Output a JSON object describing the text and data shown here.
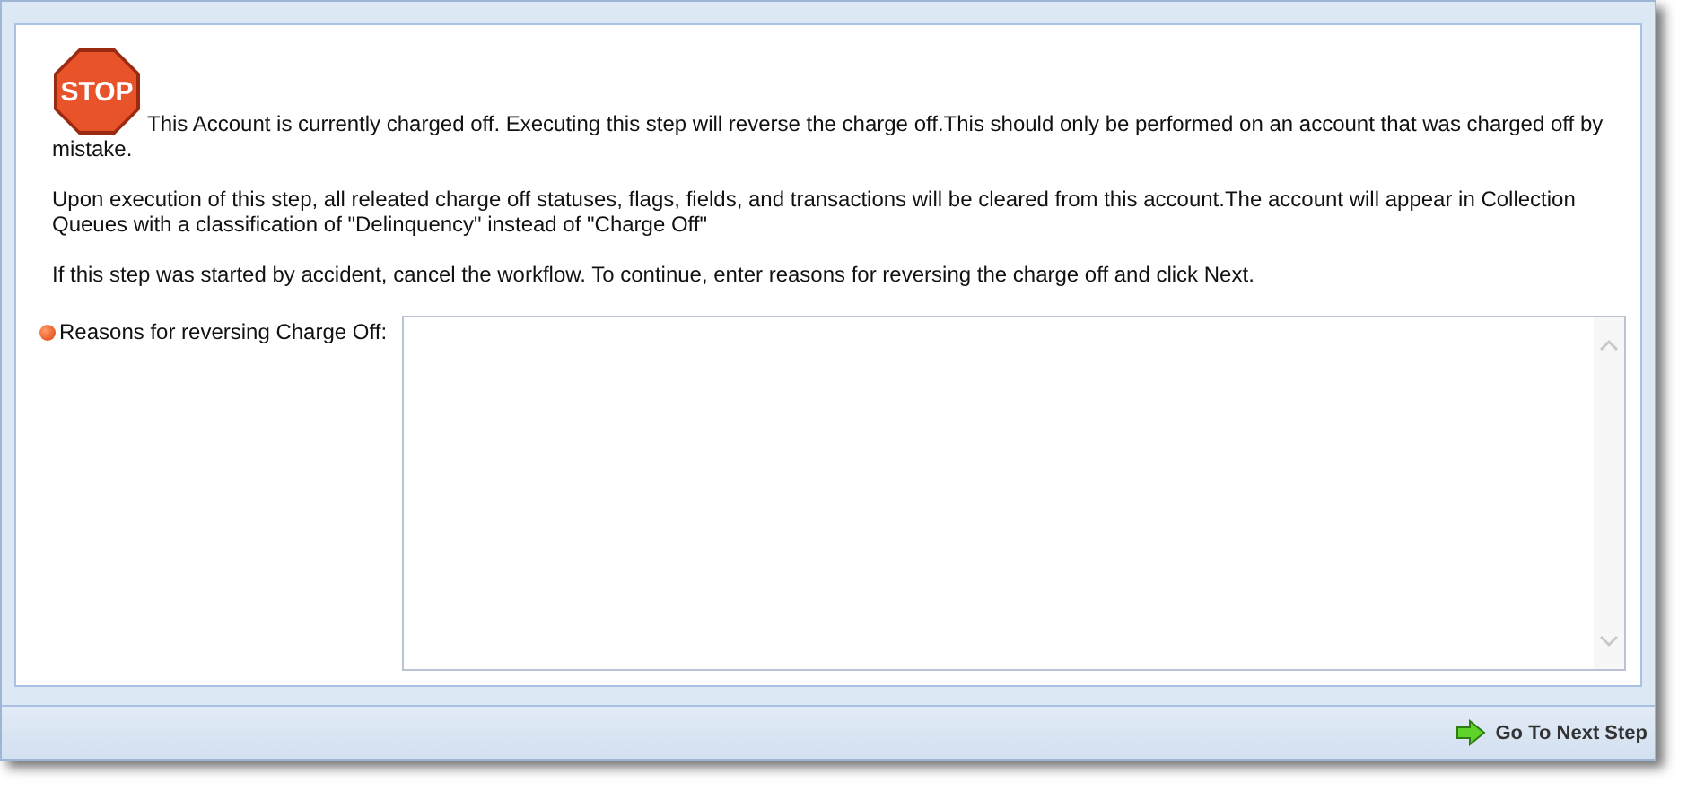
{
  "stop_sign": {
    "label": "STOP"
  },
  "paragraphs": [
    "This Account is currently charged off. Executing this step will reverse the charge off.This should only be performed on an account that was charged off by mistake.",
    "Upon execution of this step, all releated charge off statuses, flags, fields, and transactions will be cleared from this account.The account will appear in Collection Queues with a classification of \"Delinquency\" instead of \"Charge Off\"",
    "If this step was started by accident, cancel the workflow. To continue, enter reasons for reversing the charge off and click Next."
  ],
  "reasons_field": {
    "label": "Reasons for reversing Charge Off:",
    "required": true
  },
  "footer": {
    "next_button": "Go To Next Step"
  }
}
